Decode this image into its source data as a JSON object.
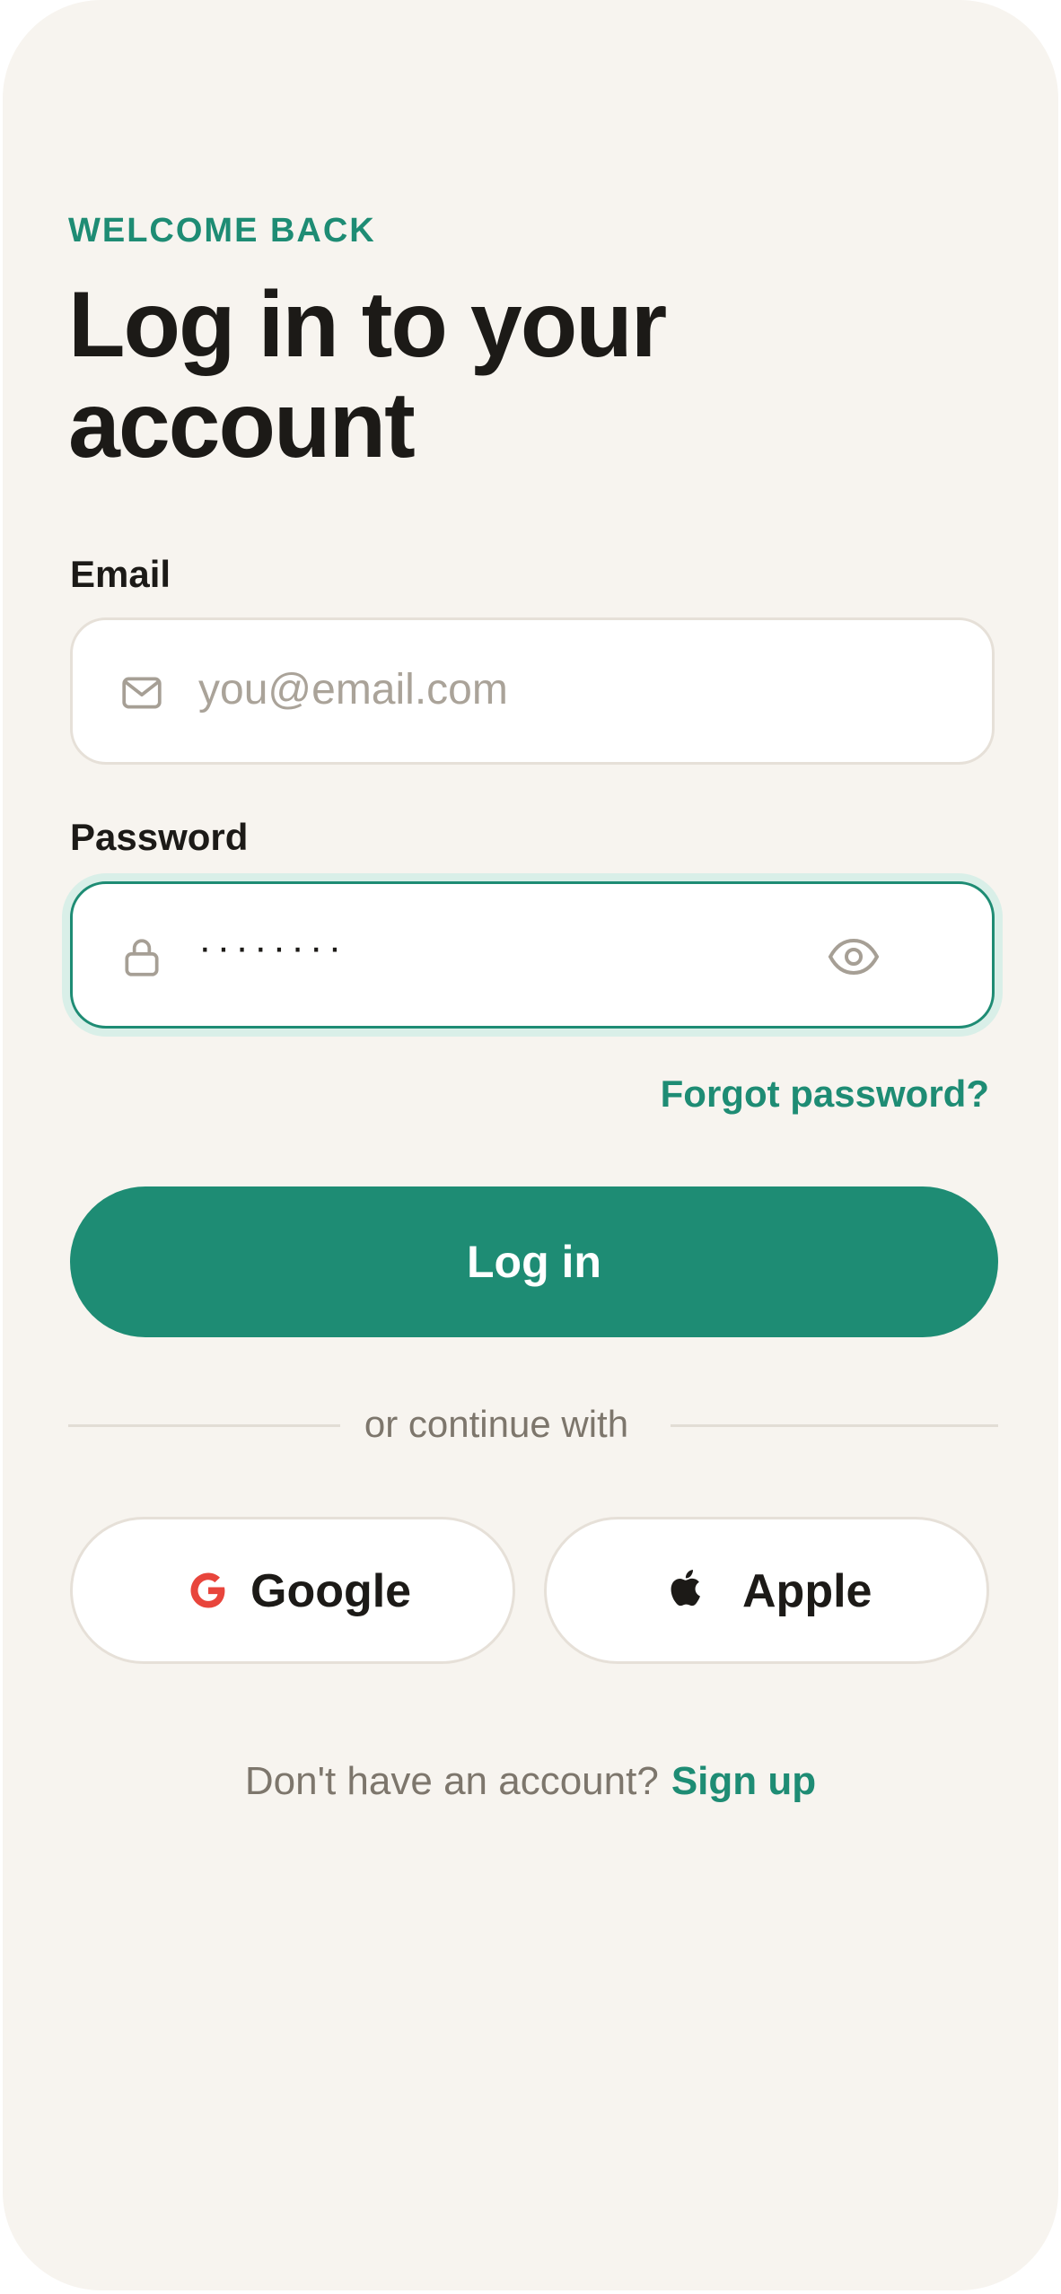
{
  "header": {
    "eyebrow": "WELCOME BACK",
    "title": "Log in to your account"
  },
  "form": {
    "email": {
      "label": "Email",
      "placeholder": "you@email.com",
      "value": "",
      "icon": "mail-icon"
    },
    "password": {
      "label": "Password",
      "value": "········",
      "icon": "lock-icon",
      "toggle_icon": "eye-icon",
      "focused": true
    },
    "forgot_label": "Forgot password?",
    "submit_label": "Log in"
  },
  "divider": {
    "text": "or continue with"
  },
  "social": [
    {
      "label": "Google",
      "icon": "google-icon"
    },
    {
      "label": "Apple",
      "icon": "apple-icon"
    }
  ],
  "footer": {
    "question": "Don't have an account?",
    "link": "Sign up"
  },
  "colors": {
    "background": "#f7f4ef",
    "accent": "#1e8c74",
    "text": "#1c1a17",
    "muted": "#7d766c",
    "border": "#e6e0d8",
    "google_red": "#e8453c"
  }
}
